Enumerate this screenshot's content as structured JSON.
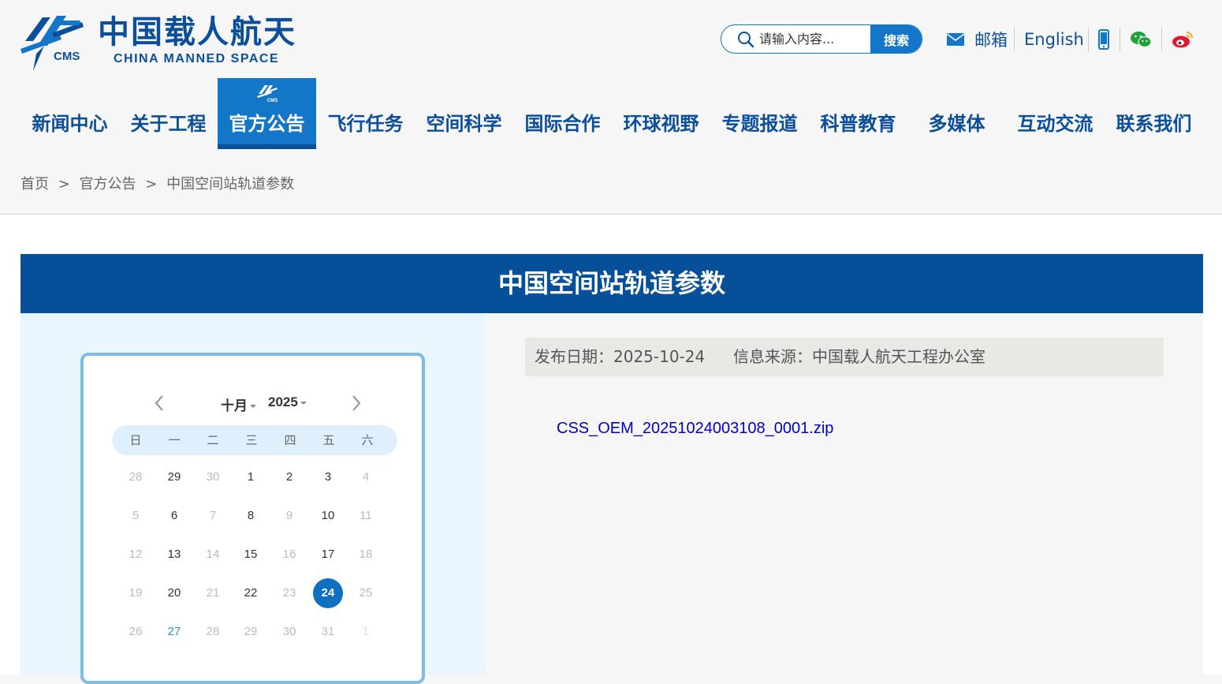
{
  "header": {
    "logo_cn": "中国载人航天",
    "logo_en": "CHINA MANNED SPACE",
    "logo_mark_text": "CMS",
    "search_placeholder": "请输入内容...",
    "search_button": "搜索",
    "mail_label": "邮箱",
    "english_label": "English"
  },
  "nav": {
    "items": [
      "新闻中心",
      "关于工程",
      "官方公告",
      "飞行任务",
      "空间科学",
      "国际合作",
      "环球视野",
      "专题报道",
      "科普教育",
      "多媒体",
      "互动交流",
      "联系我们"
    ],
    "active_index": 2
  },
  "breadcrumb": {
    "home": "首页",
    "sep": ">",
    "section": "官方公告",
    "current": "中国空间站轨道参数"
  },
  "article": {
    "title": "中国空间站轨道参数",
    "date": "发布日期：2025-10-24",
    "source": "信息来源：中国载人航天工程办公室",
    "file": "CSS_OEM_20251024003108_0001.zip"
  },
  "calendar": {
    "month": "十月",
    "year": "2025",
    "weekdays": [
      "日",
      "一",
      "二",
      "三",
      "四",
      "五",
      "六"
    ],
    "weeks": [
      [
        "28",
        "29",
        "30",
        "1",
        "2",
        "3",
        "4"
      ],
      [
        "5",
        "6",
        "7",
        "8",
        "9",
        "10",
        "11"
      ],
      [
        "12",
        "13",
        "14",
        "15",
        "16",
        "17",
        "18"
      ],
      [
        "19",
        "20",
        "21",
        "22",
        "23",
        "24",
        "25"
      ],
      [
        "26",
        "27",
        "28",
        "29",
        "30",
        "31",
        "1"
      ]
    ],
    "selected": "24"
  },
  "colors": {
    "primary": "#064f99",
    "accent": "#1476c8",
    "calendar_border": "#7cbde6"
  }
}
